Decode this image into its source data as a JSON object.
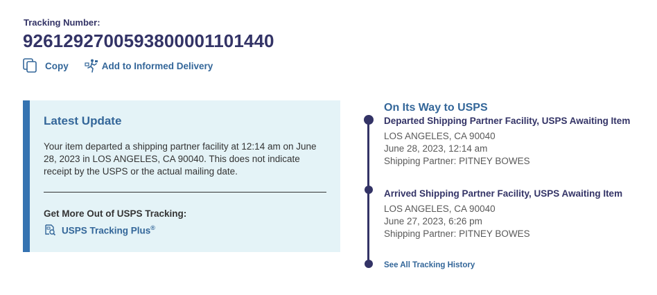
{
  "tracking": {
    "label": "Tracking Number:",
    "number": "9261292700593800001101440"
  },
  "actions": {
    "copy_label": "Copy",
    "informed_label": "Add to Informed Delivery"
  },
  "latest_update": {
    "title": "Latest Update",
    "text": "Your item departed a shipping partner facility at 12:14 am on June 28, 2023 in LOS ANGELES, CA 90040. This does not indicate receipt by the USPS or the actual mailing date.",
    "more_label": "Get More Out of USPS Tracking:",
    "plus_label": "USPS Tracking Plus",
    "plus_mark": "®"
  },
  "timeline": {
    "status": "On Its Way to USPS",
    "events": [
      {
        "title": "Departed Shipping Partner Facility, USPS Awaiting Item",
        "location": "LOS ANGELES, CA 90040",
        "datetime": "June 28, 2023, 12:14 am",
        "partner": "Shipping Partner: PITNEY BOWES"
      },
      {
        "title": "Arrived Shipping Partner Facility, USPS Awaiting Item",
        "location": "LOS ANGELES, CA 90040",
        "datetime": "June 27, 2023, 6:26 pm",
        "partner": "Shipping Partner: PITNEY BOWES"
      }
    ],
    "see_all_label": "See All Tracking History"
  },
  "colors": {
    "navy": "#333366",
    "link_blue": "#336699",
    "panel_bg": "#e4f3f7",
    "panel_border": "#3573b1"
  }
}
